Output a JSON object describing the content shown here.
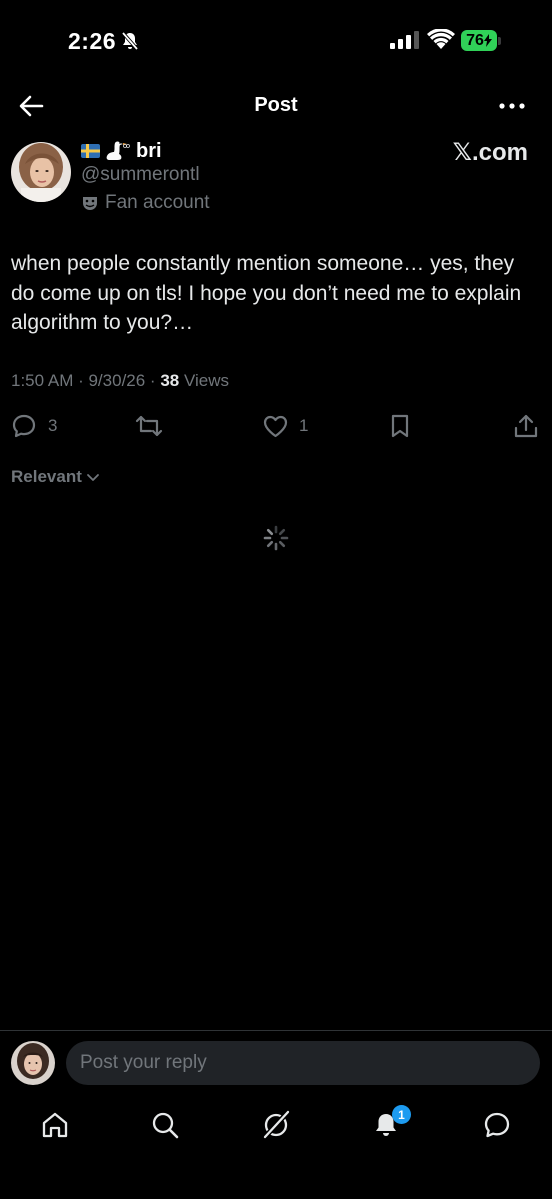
{
  "status_bar": {
    "time": "2:26",
    "battery": "76"
  },
  "header": {
    "title": "Post"
  },
  "post": {
    "author": {
      "display_name": "bri",
      "handle": "@summerontl",
      "label": "Fan account",
      "flag_icon": "sweden-flag-icon",
      "emoji_icon": "goose-icon"
    },
    "brand": "𝕏.com",
    "text": "when people constantly mention someone… yes, they do come up on tls! I hope you don’t need me to explain algorithm to you?…",
    "timestamp": "1:50 AM · 9/30/26 · ",
    "views_count": "38",
    "views_label": " Views",
    "actions": {
      "replies": "3",
      "reposts": "",
      "likes": "1"
    }
  },
  "replies_sort": {
    "label": "Relevant"
  },
  "reply_bar": {
    "placeholder": "Post your reply"
  },
  "tab_bar": {
    "notifications_badge": "1"
  },
  "colors": {
    "background": "#000000",
    "text_primary": "#e7e9ea",
    "text_secondary": "#71767b",
    "accent": "#1d9bf0",
    "battery": "#30d158"
  }
}
